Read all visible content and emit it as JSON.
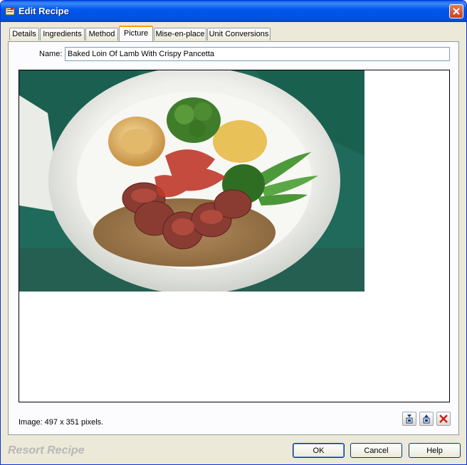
{
  "window": {
    "title": "Edit Recipe"
  },
  "tabs": [
    "Details",
    "Ingredients",
    "Method",
    "Picture",
    "Mise-en-place",
    "Unit Conversions"
  ],
  "active_tab": "Picture",
  "name": {
    "label": "Name:",
    "value": "Baked Loin Of Lamb With Crispy Pancetta"
  },
  "image": {
    "info": "Image: 497 x 351 pixels."
  },
  "image_buttons": [
    "load-image-icon",
    "copy-image-icon",
    "delete-image-icon"
  ],
  "brand": "Resort Recipe",
  "buttons": {
    "ok": "OK",
    "cancel": "Cancel",
    "help": "Help"
  },
  "colors": {
    "titlebar": "#0058ee",
    "tab_highlight": "#ff9c00",
    "window_bg": "#ece9d8"
  }
}
